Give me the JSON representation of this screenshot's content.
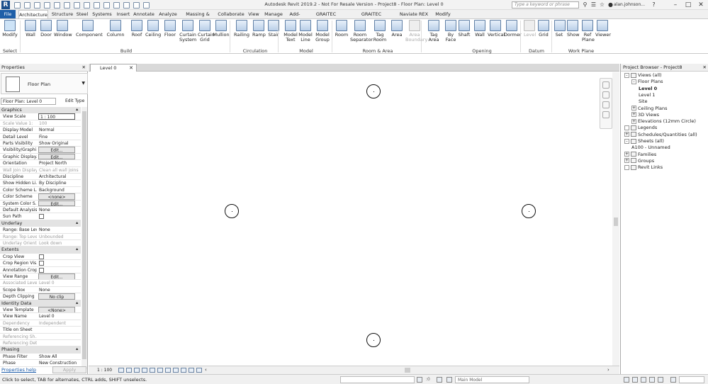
{
  "app": {
    "title": "Autodesk Revit 2019.2 - Not For Resale Version - Project8 - Floor Plan: Level 0",
    "logo": "R",
    "search_placeholder": "Type a keyword or phrase",
    "user": "alan.johnson..."
  },
  "tabs": [
    "File",
    "Architecture",
    "Structure",
    "Steel",
    "Systems",
    "Insert",
    "Annotate",
    "Analyze",
    "Massing & Site",
    "Collaborate",
    "View",
    "Manage",
    "Add-Ins",
    "GRAITEC Concrete",
    "GRAITEC PowerPack",
    "Naviate REX",
    "Modify"
  ],
  "ribbon": {
    "select_panel": "Select",
    "tools": [
      {
        "label": "Modify",
        "icon": "modify-cursor-icon"
      },
      {
        "label": "Wall",
        "icon": "wall-icon"
      },
      {
        "label": "Door",
        "icon": "door-icon"
      },
      {
        "label": "Window",
        "icon": "window-icon"
      },
      {
        "label": "Component",
        "icon": "component-icon"
      },
      {
        "label": "Column",
        "icon": "column-icon"
      },
      {
        "label": "Roof",
        "icon": "roof-icon"
      },
      {
        "label": "Ceiling",
        "icon": "ceiling-icon"
      },
      {
        "label": "Floor",
        "icon": "floor-icon"
      },
      {
        "label": "Curtain System",
        "icon": "curtain-system-icon"
      },
      {
        "label": "Curtain Grid",
        "icon": "curtain-grid-icon"
      },
      {
        "label": "Mullion",
        "icon": "mullion-icon"
      },
      {
        "label": "Railing",
        "icon": "railing-icon"
      },
      {
        "label": "Ramp",
        "icon": "ramp-icon"
      },
      {
        "label": "Stair",
        "icon": "stair-icon"
      },
      {
        "label": "Model Text",
        "icon": "model-text-icon"
      },
      {
        "label": "Model Line",
        "icon": "model-line-icon"
      },
      {
        "label": "Model Group",
        "icon": "model-group-icon"
      },
      {
        "label": "Room",
        "icon": "room-icon"
      },
      {
        "label": "Room Separator",
        "icon": "room-separator-icon"
      },
      {
        "label": "Tag Room",
        "icon": "tag-room-icon"
      },
      {
        "label": "Area",
        "icon": "area-icon"
      },
      {
        "label": "Area Boundary",
        "icon": "area-boundary-icon",
        "disabled": true
      },
      {
        "label": "Tag Area",
        "icon": "tag-area-icon"
      },
      {
        "label": "By Face",
        "icon": "by-face-icon"
      },
      {
        "label": "Shaft",
        "icon": "shaft-icon"
      },
      {
        "label": "Wall",
        "icon": "wall-opening-icon"
      },
      {
        "label": "Vertical",
        "icon": "vertical-opening-icon"
      },
      {
        "label": "Dormer",
        "icon": "dormer-icon"
      },
      {
        "label": "Level",
        "icon": "level-icon",
        "disabled": true
      },
      {
        "label": "Grid",
        "icon": "grid-icon"
      },
      {
        "label": "Set",
        "icon": "set-workplane-icon"
      },
      {
        "label": "Show",
        "icon": "show-workplane-icon"
      },
      {
        "label": "Ref Plane",
        "icon": "ref-plane-icon"
      },
      {
        "label": "Viewer",
        "icon": "viewer-icon"
      }
    ],
    "panels": [
      "Build",
      "Circulation",
      "Model",
      "Room & Area",
      "Opening",
      "Datum",
      "Work Plane"
    ]
  },
  "view_tab": {
    "label": "Level 0"
  },
  "properties": {
    "title": "Properties",
    "type_name": "Floor Plan",
    "instance_selector": "Floor Plan: Level 0",
    "edit_type": "Edit Type",
    "rows": [
      {
        "group": "Graphics"
      },
      {
        "k": "View Scale",
        "v": "1 : 100",
        "kind": "input"
      },
      {
        "k": "Scale Value    1:",
        "v": "100",
        "dim": true
      },
      {
        "k": "Display Model",
        "v": "Normal"
      },
      {
        "k": "Detail Level",
        "v": "Fine"
      },
      {
        "k": "Parts Visibility",
        "v": "Show Original"
      },
      {
        "k": "Visibility/Graphi...",
        "v": "Edit...",
        "kind": "button"
      },
      {
        "k": "Graphic Display...",
        "v": "Edit...",
        "kind": "button"
      },
      {
        "k": "Orientation",
        "v": "Project North"
      },
      {
        "k": "Wall Join Display",
        "v": "Clean all wall joins",
        "dim": true
      },
      {
        "k": "Discipline",
        "v": "Architectural"
      },
      {
        "k": "Show Hidden Li...",
        "v": "By Discipline"
      },
      {
        "k": "Color Scheme L...",
        "v": "Background"
      },
      {
        "k": "Color Scheme",
        "v": "<none>",
        "kind": "button"
      },
      {
        "k": "System Color S...",
        "v": "Edit...",
        "kind": "button"
      },
      {
        "k": "Default Analysis...",
        "v": "None"
      },
      {
        "k": "Sun Path",
        "v": "",
        "kind": "check"
      },
      {
        "group": "Underlay"
      },
      {
        "k": "Range: Base Level",
        "v": "None"
      },
      {
        "k": "Range: Top Level",
        "v": "Unbounded",
        "dim": true
      },
      {
        "k": "Underlay Orient...",
        "v": "Look down",
        "dim": true
      },
      {
        "group": "Extents"
      },
      {
        "k": "Crop View",
        "v": "",
        "kind": "check"
      },
      {
        "k": "Crop Region Vis...",
        "v": "",
        "kind": "check"
      },
      {
        "k": "Annotation Crop",
        "v": "",
        "kind": "check"
      },
      {
        "k": "View Range",
        "v": "Edit...",
        "kind": "button"
      },
      {
        "k": "Associated Level",
        "v": "Level 0",
        "dim": true
      },
      {
        "k": "Scope Box",
        "v": "None"
      },
      {
        "k": "Depth Clipping",
        "v": "No clip",
        "kind": "button"
      },
      {
        "group": "Identity Data"
      },
      {
        "k": "View Template",
        "v": "<None>",
        "kind": "button"
      },
      {
        "k": "View Name",
        "v": "Level 0"
      },
      {
        "k": "Dependency",
        "v": "Independent",
        "dim": true
      },
      {
        "k": "Title on Sheet",
        "v": ""
      },
      {
        "k": "Referencing Sh...",
        "v": "",
        "dim": true
      },
      {
        "k": "Referencing Det...",
        "v": "",
        "dim": true
      },
      {
        "group": "Phasing"
      },
      {
        "k": "Phase Filter",
        "v": "Show All"
      },
      {
        "k": "Phase",
        "v": "New Construction"
      }
    ],
    "help": "Properties help",
    "apply": "Apply"
  },
  "browser": {
    "title": "Project Browser - Project8",
    "nodes": [
      {
        "label": "Views (all)",
        "depth": 0,
        "toggle": "-",
        "icon": true
      },
      {
        "label": "Floor Plans",
        "depth": 1,
        "toggle": "-"
      },
      {
        "label": "Level 0",
        "depth": 2,
        "bold": true
      },
      {
        "label": "Level 1",
        "depth": 2
      },
      {
        "label": "Site",
        "depth": 2
      },
      {
        "label": "Ceiling Plans",
        "depth": 1,
        "toggle": "+"
      },
      {
        "label": "3D Views",
        "depth": 1,
        "toggle": "+"
      },
      {
        "label": "Elevations (12mm Circle)",
        "depth": 1,
        "toggle": "+"
      },
      {
        "label": "Legends",
        "depth": 0,
        "toggle": "",
        "icon": true
      },
      {
        "label": "Schedules/Quantities (all)",
        "depth": 0,
        "toggle": "+",
        "icon": true
      },
      {
        "label": "Sheets (all)",
        "depth": 0,
        "toggle": "-",
        "icon": true
      },
      {
        "label": "A100 - Unnamed",
        "depth": 1
      },
      {
        "label": "Families",
        "depth": 0,
        "toggle": "+",
        "icon": true
      },
      {
        "label": "Groups",
        "depth": 0,
        "toggle": "+",
        "icon": true
      },
      {
        "label": "Revit Links",
        "depth": 0,
        "toggle": "",
        "icon": true
      }
    ]
  },
  "view_control": {
    "scale": "1 : 100"
  },
  "status": {
    "message": "Click to select, TAB for alternates, CTRL adds, SHIFT unselects.",
    "workset_count": ":0",
    "model": "Main Model"
  }
}
